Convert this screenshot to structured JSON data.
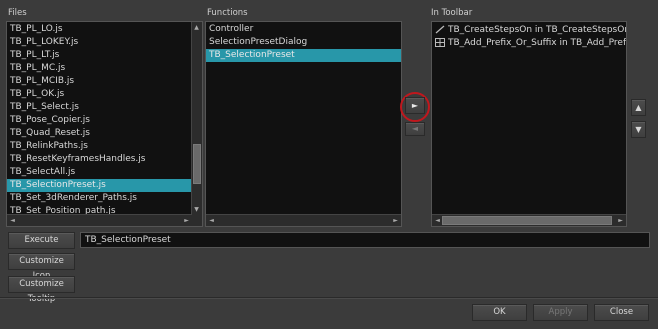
{
  "files": {
    "label": "Files",
    "items": [
      "TB_PL_LO.js",
      "TB_PL_LOKEY.js",
      "TB_PL_LT.js",
      "TB_PL_MC.js",
      "TB_PL_MCIB.js",
      "TB_PL_OK.js",
      "TB_PL_Select.js",
      "TB_Pose_Copier.js",
      "TB_Quad_Reset.js",
      "TB_RelinkPaths.js",
      "TB_ResetKeyframesHandles.js",
      "TB_SelectAll.js",
      "TB_SelectionPreset.js",
      "TB_Set_3dRenderer_Paths.js",
      "TB_Set_Position_path.js"
    ],
    "selected": "TB_SelectionPreset.js"
  },
  "functions": {
    "label": "Functions",
    "items": [
      "Controller",
      "SelectionPresetDialog",
      "TB_SelectionPreset"
    ],
    "selected": "TB_SelectionPreset"
  },
  "toolbar": {
    "label": "In Toolbar",
    "items": [
      {
        "text": "TB_CreateStepsOn in TB_CreateStepsOn.js",
        "icon": "brush-icon"
      },
      {
        "text": "TB_Add_Prefix_Or_Suffix in TB_Add_Prefix_Or_Suffix.js",
        "icon": "grid-icon"
      }
    ]
  },
  "actions": {
    "add_arrow": "►",
    "remove_arrow": "◄",
    "move_up": "▲",
    "move_down": "▼",
    "highlight_color": "#c0171d"
  },
  "execute": {
    "button_label": "Execute",
    "value": "TB_SelectionPreset"
  },
  "customize": {
    "icon_label": "Customize Icon",
    "tooltip_label": "Customize Tooltip"
  },
  "dialog": {
    "ok": "OK",
    "apply": "Apply",
    "close": "Close"
  },
  "colors": {
    "selection": "#2897a9",
    "background": "#3b3b3b",
    "list_background": "#111111"
  }
}
